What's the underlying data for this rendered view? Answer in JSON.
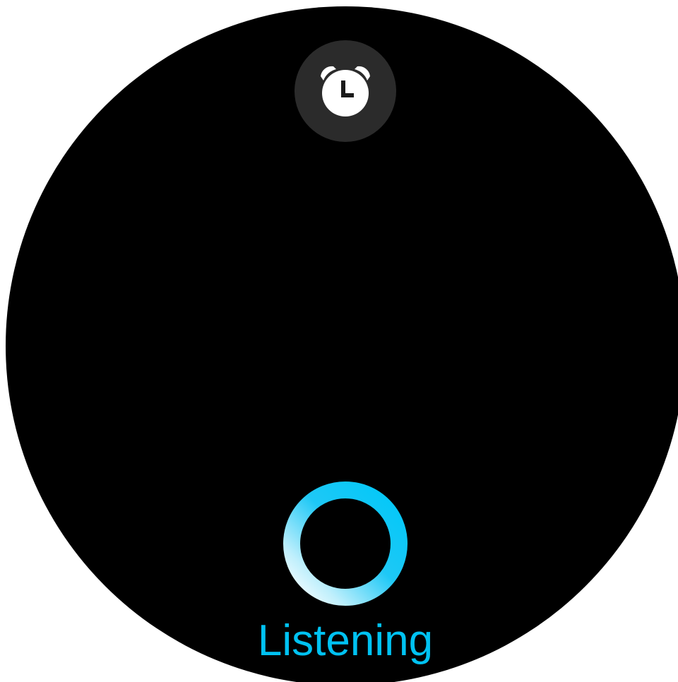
{
  "app": {
    "icon": "alarm-clock-icon",
    "badge_color": "#2b2b2b"
  },
  "assistant": {
    "status_text": "Listening",
    "ring_icon": "listening-ring-icon",
    "accent_color": "#00c2f2"
  },
  "colors": {
    "background": "#000000",
    "ring_start": "#00c8f8",
    "ring_end": "#ffffff"
  }
}
